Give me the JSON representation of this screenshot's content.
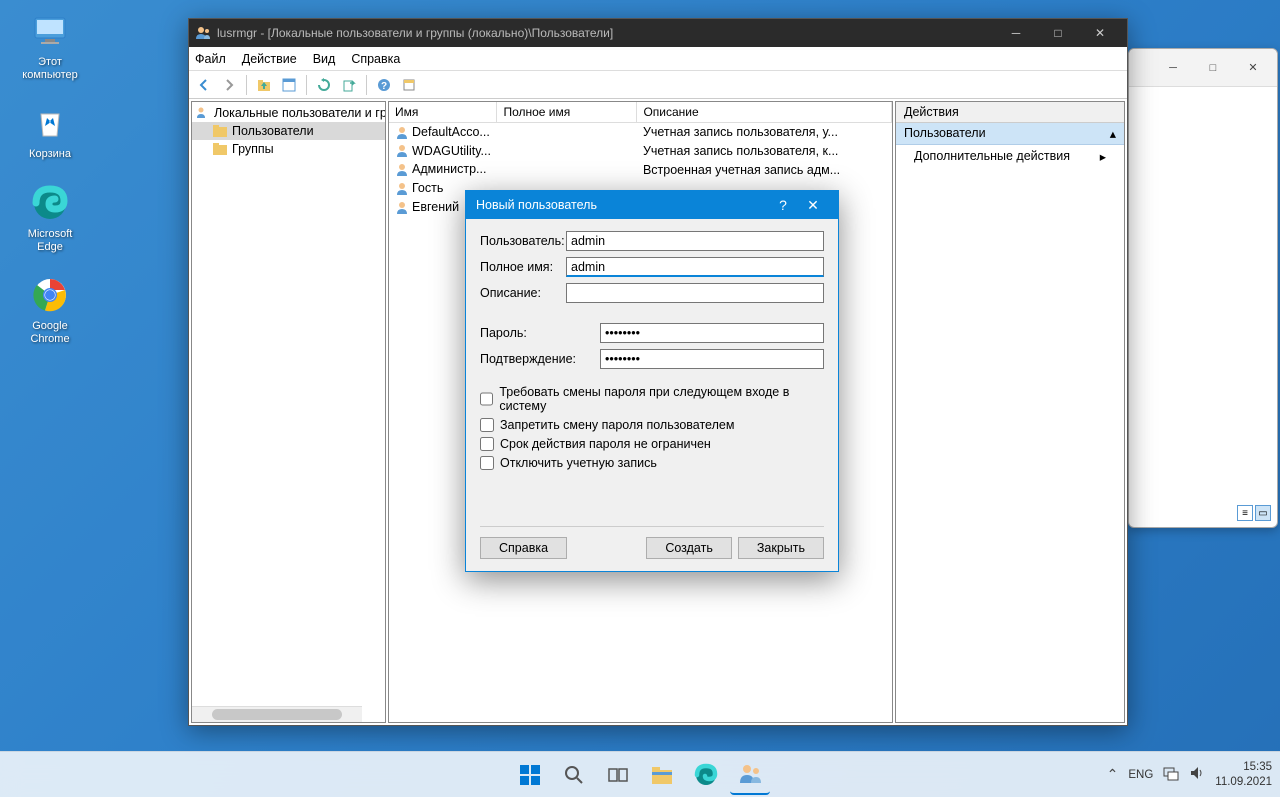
{
  "desktop": {
    "icons": [
      {
        "name": "this-pc",
        "label": "Этот\nкомпьютер"
      },
      {
        "name": "recycle-bin",
        "label": "Корзина"
      },
      {
        "name": "edge",
        "label": "Microsoft\nEdge"
      },
      {
        "name": "chrome",
        "label": "Google\nChrome"
      }
    ]
  },
  "mmc": {
    "title": "lusrmgr - [Локальные пользователи и группы (локально)\\Пользователи]",
    "menu": {
      "file": "Файл",
      "action": "Действие",
      "view": "Вид",
      "help": "Справка"
    },
    "tree": {
      "root": "Локальные пользователи и гру",
      "users": "Пользователи",
      "groups": "Группы"
    },
    "columns": {
      "name": "Имя",
      "fullname": "Полное имя",
      "description": "Описание"
    },
    "rows": [
      {
        "name": "DefaultAcco...",
        "full": "",
        "desc": "Учетная запись пользователя, у..."
      },
      {
        "name": "WDAGUtility...",
        "full": "",
        "desc": "Учетная запись пользователя, к..."
      },
      {
        "name": "Администр...",
        "full": "",
        "desc": "Встроенная учетная запись адм..."
      },
      {
        "name": "Гость",
        "full": "",
        "desc": ""
      },
      {
        "name": "Евгений",
        "full": "",
        "desc": ""
      }
    ],
    "actions": {
      "header": "Действия",
      "selected": "Пользователи",
      "more": "Дополнительные действия"
    }
  },
  "dialog": {
    "title": "Новый пользователь",
    "labels": {
      "user": "Пользователь:",
      "fullname": "Полное имя:",
      "description": "Описание:",
      "password": "Пароль:",
      "confirm": "Подтверждение:"
    },
    "values": {
      "user": "admin",
      "fullname": "admin",
      "description": "",
      "password": "••••••••",
      "confirm": "••••••••"
    },
    "checks": {
      "must_change": "Требовать смены пароля при следующем входе в систему",
      "cannot_change": "Запретить смену пароля пользователем",
      "never_expires": "Срок действия пароля не ограничен",
      "disabled": "Отключить учетную запись"
    },
    "buttons": {
      "help": "Справка",
      "create": "Создать",
      "close": "Закрыть"
    }
  },
  "taskbar": {
    "lang": "ENG",
    "time": "15:35",
    "date": "11.09.2021"
  }
}
